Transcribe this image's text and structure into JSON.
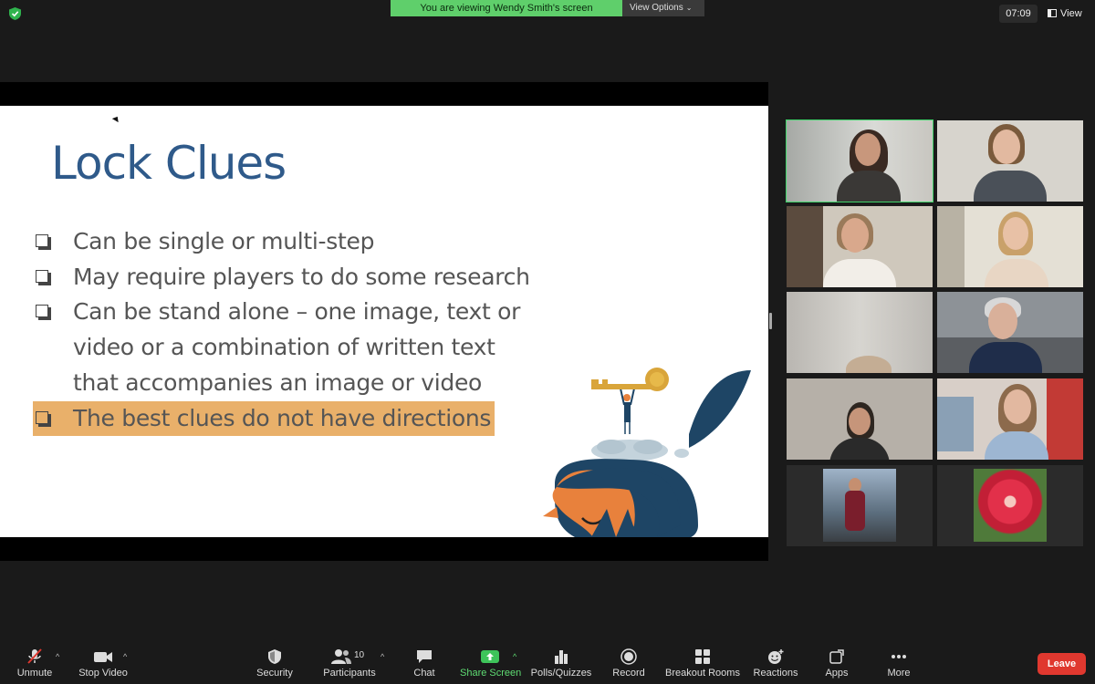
{
  "top_bar": {
    "security_icon": "shield-check-icon",
    "viewing_banner": "You are viewing Wendy Smith's screen",
    "view_options": "View Options",
    "clock": "07:09",
    "view_label": "View"
  },
  "slide": {
    "title": "Lock Clues",
    "bullets": [
      "Can be single or multi-step",
      "May require players to do some research",
      "Can be stand alone –  one image, text or",
      "video or a combination of written text",
      "that accompanies an image or video"
    ],
    "highlight_bullet": "The best clues do not have directions",
    "highlight_color": "#e9b06a",
    "title_color": "#2f5a8a"
  },
  "toolbar": {
    "unmute": "Unmute",
    "stop_video": "Stop Video",
    "security": "Security",
    "participants": "Participants",
    "participants_count": "10",
    "chat": "Chat",
    "share_screen": "Share Screen",
    "polls": "Polls/Quizzes",
    "record": "Record",
    "breakout": "Breakout Rooms",
    "reactions": "Reactions",
    "apps": "Apps",
    "more": "More",
    "leave": "Leave"
  },
  "colors": {
    "active_speaker": "#3fd46a",
    "share_green": "#5fdc73",
    "leave_red": "#e0382f"
  }
}
